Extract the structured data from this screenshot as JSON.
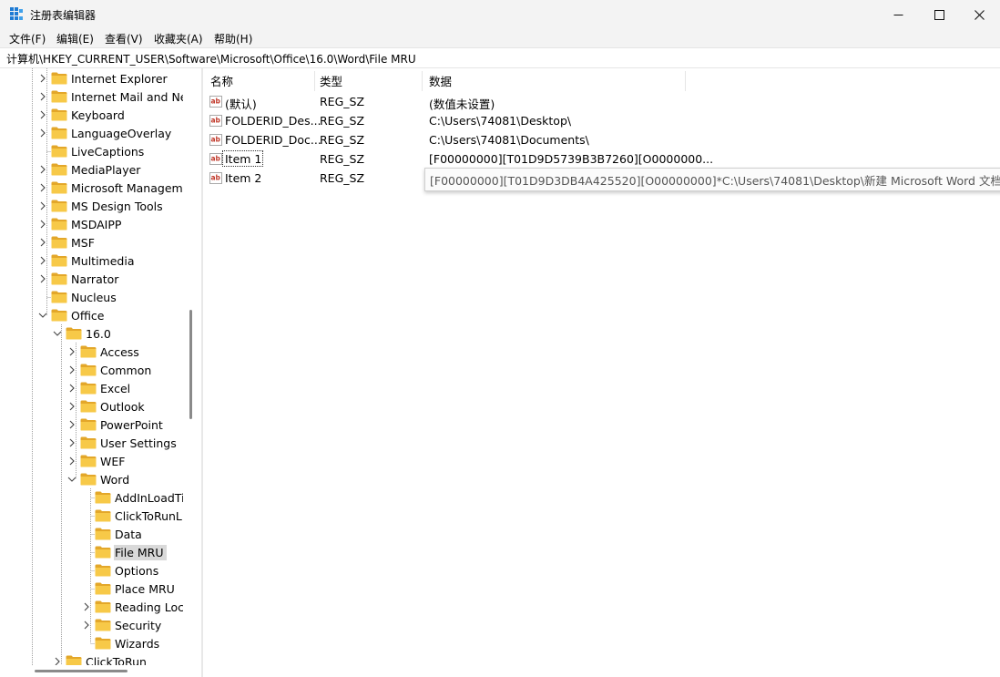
{
  "window": {
    "title": "注册表编辑器",
    "controls": {
      "minimize": "minimize-icon",
      "maximize": "maximize-icon",
      "close": "close-icon"
    }
  },
  "menu": [
    "文件(F)",
    "编辑(E)",
    "查看(V)",
    "收藏夹(A)",
    "帮助(H)"
  ],
  "address": "计算机\\HKEY_CURRENT_USER\\Software\\Microsoft\\Office\\16.0\\Word\\File MRU",
  "tree": {
    "items": [
      {
        "label": "Internet Explorer",
        "level": 0,
        "expander": "collapsed"
      },
      {
        "label": "Internet Mail and News",
        "level": 0,
        "expander": "collapsed"
      },
      {
        "label": "Keyboard",
        "level": 0,
        "expander": "collapsed"
      },
      {
        "label": "LanguageOverlay",
        "level": 0,
        "expander": "collapsed"
      },
      {
        "label": "LiveCaptions",
        "level": 0,
        "expander": "none"
      },
      {
        "label": "MediaPlayer",
        "level": 0,
        "expander": "collapsed"
      },
      {
        "label": "Microsoft Management Console",
        "level": 0,
        "expander": "collapsed"
      },
      {
        "label": "MS Design Tools",
        "level": 0,
        "expander": "collapsed"
      },
      {
        "label": "MSDAIPP",
        "level": 0,
        "expander": "collapsed"
      },
      {
        "label": "MSF",
        "level": 0,
        "expander": "collapsed"
      },
      {
        "label": "Multimedia",
        "level": 0,
        "expander": "collapsed"
      },
      {
        "label": "Narrator",
        "level": 0,
        "expander": "collapsed"
      },
      {
        "label": "Nucleus",
        "level": 0,
        "expander": "none"
      },
      {
        "label": "Office",
        "level": 0,
        "expander": "expanded"
      },
      {
        "label": "16.0",
        "level": 1,
        "expander": "expanded"
      },
      {
        "label": "Access",
        "level": 2,
        "expander": "collapsed"
      },
      {
        "label": "Common",
        "level": 2,
        "expander": "collapsed"
      },
      {
        "label": "Excel",
        "level": 2,
        "expander": "collapsed"
      },
      {
        "label": "Outlook",
        "level": 2,
        "expander": "collapsed"
      },
      {
        "label": "PowerPoint",
        "level": 2,
        "expander": "collapsed"
      },
      {
        "label": "User Settings",
        "level": 2,
        "expander": "collapsed"
      },
      {
        "label": "WEF",
        "level": 2,
        "expander": "collapsed"
      },
      {
        "label": "Word",
        "level": 2,
        "expander": "expanded"
      },
      {
        "label": "AddInLoadTimes",
        "level": 3,
        "expander": "none"
      },
      {
        "label": "ClickToRunLicensing",
        "level": 3,
        "expander": "none"
      },
      {
        "label": "Data",
        "level": 3,
        "expander": "none"
      },
      {
        "label": "File MRU",
        "level": 3,
        "expander": "none",
        "selected": true
      },
      {
        "label": "Options",
        "level": 3,
        "expander": "none"
      },
      {
        "label": "Place MRU",
        "level": 3,
        "expander": "none"
      },
      {
        "label": "Reading Locations",
        "level": 3,
        "expander": "collapsed"
      },
      {
        "label": "Security",
        "level": 3,
        "expander": "collapsed"
      },
      {
        "label": "Wizards",
        "level": 3,
        "expander": "none"
      },
      {
        "label": "ClickToRun",
        "level": 1,
        "expander": "collapsed"
      }
    ]
  },
  "list": {
    "columns": [
      "名称",
      "类型",
      "数据"
    ],
    "rows": [
      {
        "name": "(默认)",
        "type": "REG_SZ",
        "data": "(数值未设置)"
      },
      {
        "name": "FOLDERID_Des...",
        "type": "REG_SZ",
        "data": "C:\\Users\\74081\\Desktop\\"
      },
      {
        "name": "FOLDERID_Doc...",
        "type": "REG_SZ",
        "data": "C:\\Users\\74081\\Documents\\"
      },
      {
        "name": "Item 1",
        "type": "REG_SZ",
        "data": "[F00000000][T01D9D5739B3B7260][O0000000..."
      },
      {
        "name": "Item 2",
        "type": "REG_SZ",
        "data": ""
      }
    ],
    "tooltip": "[F00000000][T01D9D3DB4A425520][O00000000]*C:\\Users\\74081\\Desktop\\新建 Microsoft Word 文档.docx"
  },
  "colors": {
    "folder": "#f7c948",
    "folder_dark": "#e3a72a",
    "ab_icon": "#c0392b",
    "selection": "#d9d9d9"
  }
}
